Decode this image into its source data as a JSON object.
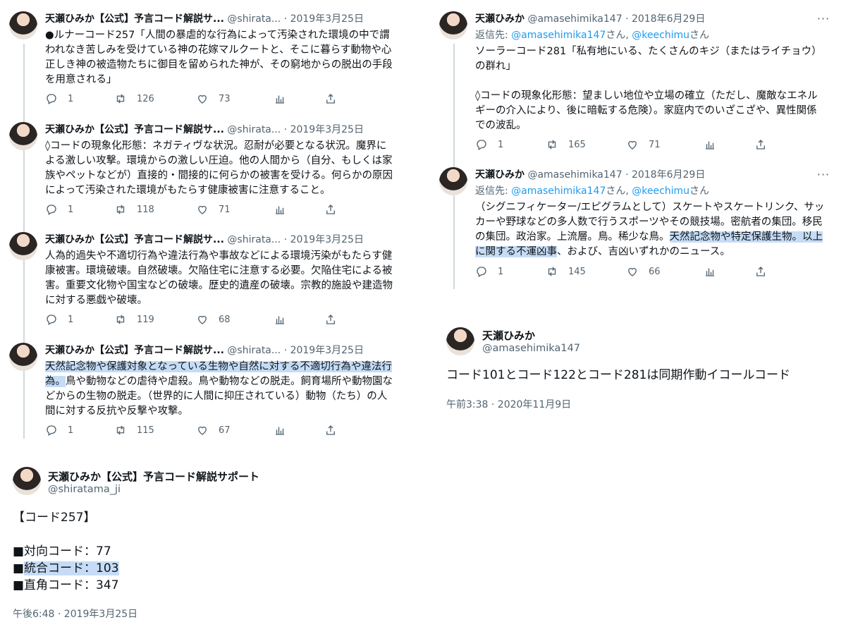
{
  "left": {
    "thread": [
      {
        "name": "天瀬ひみか【公式】予言コード解説サ...",
        "handle": "@shirata...",
        "date": "· 2019年3月25日",
        "lines": [
          "●ルナーコード257「人間の暴虐的な行為によって汚染された環境の中で謂",
          "われなき苦しみを受けている神の花嫁マルクートと、そこに暮らす動物や心",
          "正しき神の被造物たちに御目を留められた神が、その窮地からの脱出の手段",
          "を用意される」"
        ],
        "replies": "1",
        "retweets": "126",
        "likes": "73"
      },
      {
        "name": "天瀬ひみか【公式】予言コード解説サ...",
        "handle": "@shirata...",
        "date": "· 2019年3月25日",
        "lines": [
          "◊コードの現象化形態：ネガティヴな状況。忍耐が必要となる状況。魔界に",
          "よる激しい攻撃。環境からの激しい圧迫。他の人間から（自分、もしくは家",
          "族やペットなどが）直接的・間接的に何らかの被害を受ける。何らかの原因",
          "によって汚染された環境がもたらす健康被害に注意すること。"
        ],
        "replies": "1",
        "retweets": "118",
        "likes": "71"
      },
      {
        "name": "天瀬ひみか【公式】予言コード解説サ...",
        "handle": "@shirata...",
        "date": "· 2019年3月25日",
        "lines": [
          "人為的過失や不適切行為や違法行為や事故などによる環境汚染がもたらす健",
          "康被害。環境破壊。自然破壊。欠陥住宅に注意する必要。欠陥住宅による被",
          "害。重要文化物や国宝などの破壊。歴史的遺産の破壊。宗教的施設や建造物",
          "に対する悪戯や破壊。"
        ],
        "replies": "1",
        "retweets": "119",
        "likes": "68"
      },
      {
        "name": "天瀬ひみか【公式】予言コード解説サ...",
        "handle": "@shirata...",
        "date": "· 2019年3月25日",
        "line1": "天然記念物や保護対象となっている生物や自然に対する不適切行為や違法行",
        "line2_hl": "為。",
        "line2_rest": "鳥や動物などの虐待や虐殺。鳥や動物などの脱走。飼育場所や動物園な",
        "line3": "どからの生物の脱走。（世界的に人間に抑圧されている）動物（たち）の人",
        "line4": "間に対する反抗や反撃や攻撃。",
        "replies": "1",
        "retweets": "115",
        "likes": "67"
      }
    ],
    "main": {
      "name": "天瀬ひみか【公式】予言コード解説サポート",
      "handle": "@shiratama_ji",
      "title": "【コード257】",
      "item1": "■対向コード：77",
      "item2_mark": "■",
      "item2_hl": "統合コード：103",
      "item3": "■直角コード：347",
      "time": "午後6:48 · 2019年3月25日"
    }
  },
  "right": {
    "thread": [
      {
        "name": "天瀬ひみか",
        "handle": "@amasehimika147",
        "date": "· 2018年6月29日",
        "reply_prefix": "返信先: ",
        "mention1": "@amasehimika147",
        "mid": "さん, ",
        "mention2": "@keechimu",
        "suffix": "さん",
        "lines": [
          "ソーラーコード281「私有地にいる、たくさんのキジ（またはライチョウ）",
          "の群れ」"
        ],
        "lines2": [
          "◊コードの現象化形態：望ましい地位や立場の確立（ただし、魔敵なエネル",
          "ギーの介入により、後に暗転する危険）。家庭内でのいざこざや、異性関係",
          "での波乱。"
        ],
        "replies": "1",
        "retweets": "165",
        "likes": "71"
      },
      {
        "name": "天瀬ひみか",
        "handle": "@amasehimika147",
        "date": "· 2018年6月29日",
        "reply_prefix": "返信先: ",
        "mention1": "@amasehimika147",
        "mid": "さん, ",
        "mention2": "@keechimu",
        "suffix": "さん",
        "line1": "（シグニフィケーター/エピグラムとして）スケートやスケートリンク、サッ",
        "line2": "カーや野球などの多人数で行うスポーツやその競技場。密航者の集団。移民",
        "line3_plain": "の集団。政治家。上流層。鳥。稀少な鳥。",
        "line3_hl": "天然記念物や特定保護生物。以上",
        "line4_hl": "に関する不運凶事",
        "line4_rest": "、および、吉凶いずれかのニュース。",
        "replies": "1",
        "retweets": "145",
        "likes": "66"
      }
    ],
    "main": {
      "name": "天瀬ひみか",
      "handle": "@amasehimika147",
      "text": "コード101とコード122とコード281は同期作動イコールコード",
      "time": "午前3:38 · 2020年11月9日"
    }
  },
  "icons": [
    "more-icon",
    "reply-icon",
    "retweet-icon",
    "like-icon",
    "analytics-icon",
    "share-icon"
  ],
  "colors": {
    "text": "#0f1419",
    "secondary": "#536471",
    "link": "#1d9bf0",
    "highlight": "#c6dcf6",
    "thread_line": "#cfd9de"
  }
}
